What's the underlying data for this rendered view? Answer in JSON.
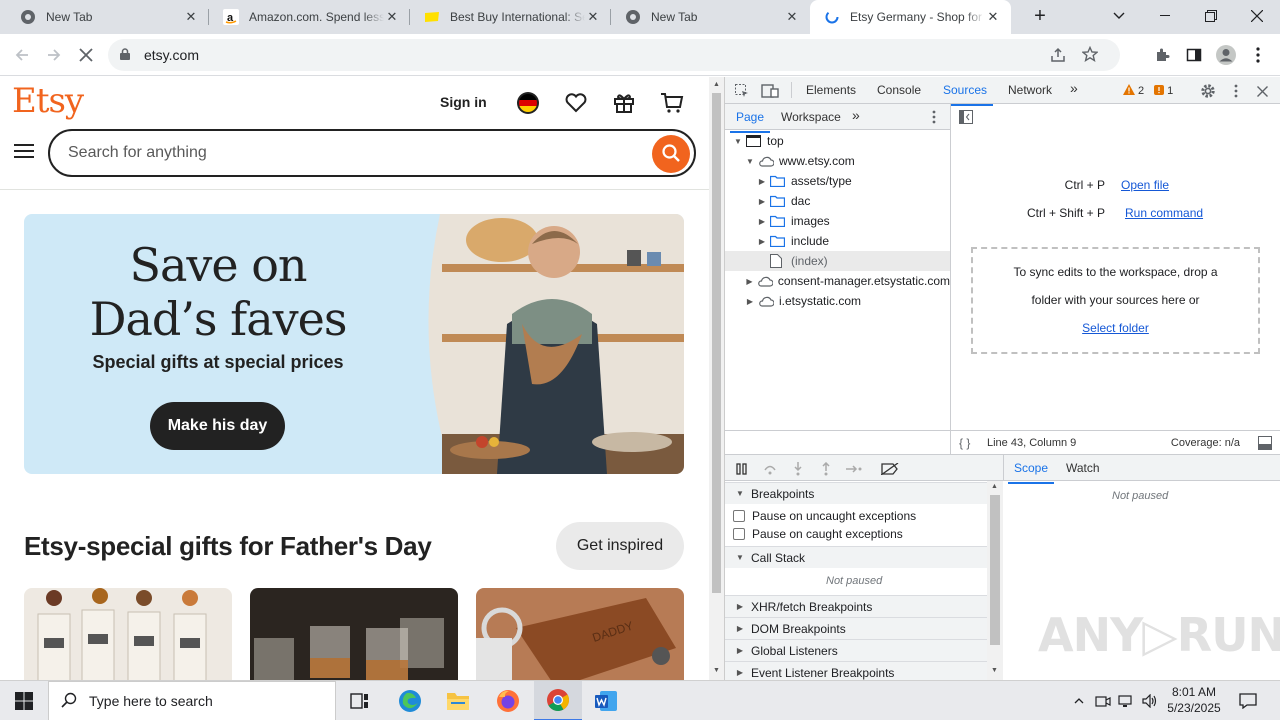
{
  "browser": {
    "tabs": [
      {
        "title": "New Tab",
        "icon": "chrome-icon"
      },
      {
        "title": "Amazon.com. Spend less. Smile more.",
        "icon": "amazon-icon"
      },
      {
        "title": "Best Buy International: Select your Country",
        "icon": "bestbuy-icon"
      },
      {
        "title": "New Tab",
        "icon": "chrome-icon"
      },
      {
        "title": "Etsy Germany - Shop for handmade",
        "icon": "loading-icon"
      }
    ],
    "close_glyph": "✕",
    "new_tab_glyph": "+",
    "url": "etsy.com"
  },
  "etsy": {
    "logo": "Etsy",
    "sign_in": "Sign in",
    "search_placeholder": "Search for anything",
    "hero": {
      "line1": "Save on",
      "line2": "Dad’s faves",
      "subtitle": "Special gifts at special prices",
      "button": "Make his day",
      "bg_color": "#cfe9f7"
    },
    "section_title": "Etsy-special gifts for Father's Day",
    "inspire_button": "Get inspired",
    "accent": "#f1641e"
  },
  "devtools": {
    "tabs": [
      "Elements",
      "Console",
      "Sources",
      "Network"
    ],
    "active_tab": "Sources",
    "more_glyph": "»",
    "warnings": "2",
    "issues": "1",
    "navigator_tabs": [
      "Page",
      "Workspace"
    ],
    "tree": [
      {
        "label": "top",
        "type": "frame",
        "depth": 0,
        "expanded": true
      },
      {
        "label": "www.etsy.com",
        "type": "cloud",
        "depth": 1,
        "expanded": true
      },
      {
        "label": "assets/type",
        "type": "folder",
        "depth": 2,
        "expanded": false
      },
      {
        "label": "dac",
        "type": "folder",
        "depth": 2,
        "expanded": false
      },
      {
        "label": "images",
        "type": "folder",
        "depth": 2,
        "expanded": false
      },
      {
        "label": "include",
        "type": "folder",
        "depth": 2,
        "expanded": false
      },
      {
        "label": "(index)",
        "type": "file",
        "depth": 2,
        "selected": true
      },
      {
        "label": "consent-manager.etsystatic.com",
        "type": "cloud",
        "depth": 1,
        "expanded": false
      },
      {
        "label": "i.etsystatic.com",
        "type": "cloud",
        "depth": 1,
        "expanded": false
      }
    ],
    "shortcuts": [
      {
        "keys": "Ctrl + P",
        "action": "Open file"
      },
      {
        "keys": "Ctrl + Shift + P",
        "action": "Run command"
      }
    ],
    "dropzone_text_1": "To sync edits to the workspace, drop a",
    "dropzone_text_2": "folder with your sources here or",
    "dropzone_link": "Select folder",
    "status_position": "Line 43, Column 9",
    "coverage": "Coverage: n/a",
    "scope_tabs": [
      "Scope",
      "Watch"
    ],
    "not_paused": "Not paused",
    "breakpoints_title": "Breakpoints",
    "pause_uncaught": "Pause on uncaught exceptions",
    "pause_caught": "Pause on caught exceptions",
    "call_stack": "Call Stack",
    "sections": [
      "XHR/fetch Breakpoints",
      "DOM Breakpoints",
      "Global Listeners",
      "Event Listener Breakpoints"
    ]
  },
  "taskbar": {
    "search_placeholder": "Type here to search",
    "time": "8:01 AM",
    "date": "5/23/2025"
  },
  "watermark": "ANY▷RUN"
}
